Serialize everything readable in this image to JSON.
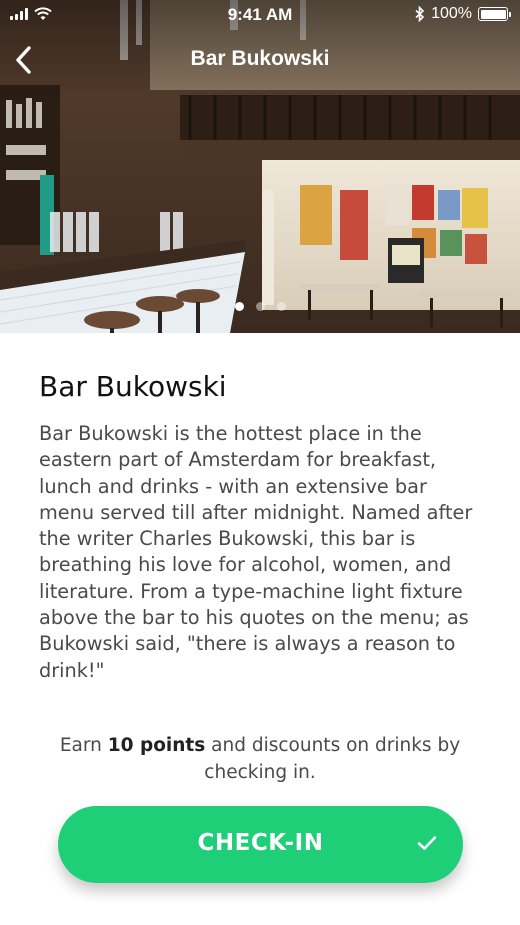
{
  "status_bar": {
    "time": "9:41 AM",
    "battery_percent": "100%",
    "battery_level": 1.0,
    "signal_icon": "cellular-signal-icon",
    "wifi_icon": "wifi-icon",
    "bluetooth_icon": "bluetooth-icon"
  },
  "nav": {
    "title": "Bar Bukowski",
    "back_icon": "chevron-left-icon"
  },
  "gallery": {
    "page_count": 3,
    "active_page": 1
  },
  "venue": {
    "name": "Bar Bukowski",
    "description": "Bar Bukowski is the hottest place in the eastern part of Amsterdam for breakfast, lunch and drinks - with an extensive bar menu served till after midnight. Named after the writer Charles Bukowski, this bar is breathing his love for alcohol, women, and literature. From a type-machine light fixture above the bar to his quotes on the menu; as Bukowski said, \"there is always a reason to drink!\""
  },
  "reward": {
    "prefix": "Earn ",
    "points": "10 points",
    "suffix": " and discounts on drinks by checking in."
  },
  "checkin": {
    "label": "CHECK-IN",
    "icon": "checkmark-icon",
    "color": "#1fcf78"
  }
}
